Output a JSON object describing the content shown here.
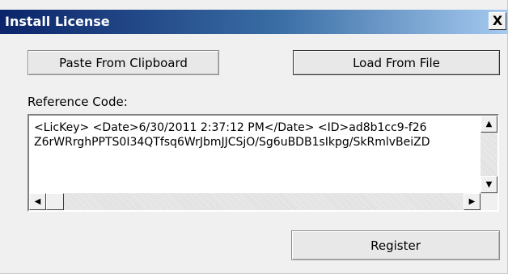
{
  "window": {
    "title": "Install License",
    "close_glyph": "X"
  },
  "buttons": {
    "paste_label": "Paste From Clipboard",
    "load_label": "Load From File",
    "register_label": "Register"
  },
  "reference": {
    "label": "Reference Code:",
    "lines": [
      "<LicKey>  <Date>6/30/2011 2:37:12 PM</Date>  <ID>ad8b1cc9-f26",
      "Z6rWRrghPPTS0I34QTfsq6WrJbmJJCSjO/Sg6uBDB1sIkpg/SkRmlvBeiZD"
    ]
  },
  "scrollbar_glyphs": {
    "up": "▲",
    "down": "▼",
    "left": "◀",
    "right": "▶"
  },
  "icons": [
    "close-icon",
    "arrow-up-icon",
    "arrow-down-icon",
    "arrow-left-icon",
    "arrow-right-icon"
  ],
  "colors": {
    "titlebar_start": "#0b246a",
    "titlebar_end": "#a6caf0",
    "dialog_bg": "#f0f0f0"
  }
}
